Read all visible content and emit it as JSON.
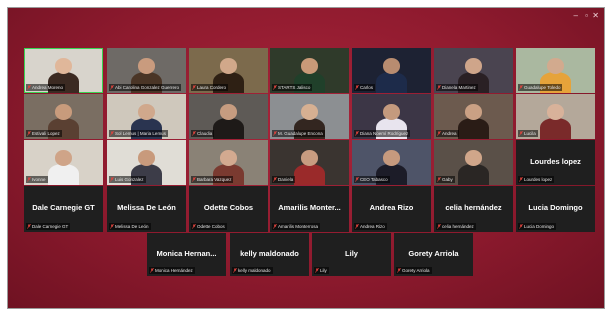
{
  "window_controls": {
    "minimize": "–",
    "maximize": "▫",
    "close": "✕"
  },
  "colors": {
    "background": "#8e1a2e",
    "tile": "#1f1f1f",
    "active_speaker": "#39d353",
    "muted_icon": "#e0443e"
  },
  "participants": [
    {
      "label": "Andrea Moreno"
    },
    {
      "label": "Abi Carolina Gonzalez Guerrero"
    },
    {
      "label": "Laura Cordero"
    },
    {
      "label": "STARTS Jalisco"
    },
    {
      "label": "Carlos"
    },
    {
      "label": "Dianela Martinez"
    },
    {
      "label": "Guadalupe Toledo"
    },
    {
      "label": "Estivali Lopez"
    },
    {
      "label": "Sol Lemus | Maria Lemus"
    },
    {
      "label": "Claudia"
    },
    {
      "label": "M. Guadalupe Encona"
    },
    {
      "label": "Diana Noemí Rodríguez"
    },
    {
      "label": "Andrea"
    },
    {
      "label": "Lucila"
    },
    {
      "label": "Ivonne"
    },
    {
      "label": "Luis Gonzalez"
    },
    {
      "label": "Barbara Vazquez"
    },
    {
      "label": "Daniela"
    },
    {
      "label": "CEO Tabasco"
    },
    {
      "label": "Gaby"
    },
    {
      "name": "Lourdes lopez",
      "label": "Lourdes lopez"
    },
    {
      "name": "Dale Carnegie GT",
      "label": "Dale Carnegie GT"
    },
    {
      "name": "Melissa De León",
      "label": "Melissa De León"
    },
    {
      "name": "Odette Cobos",
      "label": "Odette Cobos"
    },
    {
      "name": "Amarilis  Monter...",
      "label": "Amarilis Monterrosa"
    },
    {
      "name": "Andrea Rizo",
      "label": "Andrea Rizo"
    },
    {
      "name": "celia hernández",
      "label": "celia hernández"
    },
    {
      "name": "Lucia Domingo",
      "label": "Lucia Domingo"
    },
    {
      "name": "Monica Hernan...",
      "label": "Monica Hernández"
    },
    {
      "name": "kelly maldonado",
      "label": "kelly maldonado"
    },
    {
      "name": "Lily",
      "label": "Lily"
    },
    {
      "name": "Gorety Arriola",
      "label": "Gorety Arriola"
    }
  ]
}
